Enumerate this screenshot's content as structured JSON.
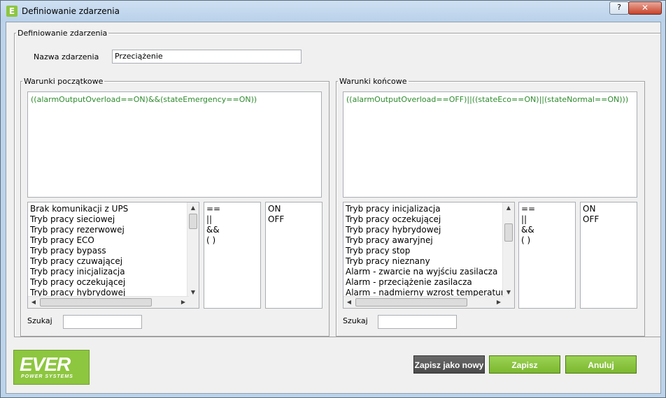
{
  "window": {
    "title": "Definiowanie zdarzenia",
    "app_icon_letter": "E",
    "help": "?",
    "close": "✕"
  },
  "main_group": {
    "legend": "Definiowanie zdarzenia"
  },
  "event_name": {
    "label": "Nazwa zdarzenia",
    "value": "Przeciążenie"
  },
  "start": {
    "legend": "Warunki początkowe",
    "condition": "((alarmOutputOverload==ON)&&(stateEmergency==ON))",
    "items": [
      "Brak komunikacji z UPS",
      "Tryb pracy sieciowej",
      "Tryb pracy rezerwowej",
      "Tryb pracy ECO",
      "Tryb pracy bypass",
      "Tryb pracy czuwającej",
      "Tryb pracy inicjalizacja",
      "Tryb pracy oczekującej",
      "Tryb pracy hybrydowej"
    ],
    "operators": [
      "==",
      "||",
      "&&",
      "( )"
    ],
    "values": [
      "ON",
      "OFF"
    ],
    "search_label": "Szukaj",
    "search_value": ""
  },
  "end": {
    "legend": "Warunki końcowe",
    "condition": "((alarmOutputOverload==OFF)||((stateEco==ON)||(stateNormal==ON)))",
    "items": [
      "Tryb pracy inicjalizacja",
      "Tryb pracy oczekującej",
      "Tryb pracy hybrydowej",
      "Tryb pracy awaryjnej",
      "Tryb pracy stop",
      "Tryb pracy nieznany",
      "Alarm - zwarcie na wyjściu zasilacza",
      "Alarm - przeciążenie zasilacza",
      "Alarm - nadmierny wzrost temperatury pro"
    ],
    "operators": [
      "==",
      "||",
      "&&",
      "( )"
    ],
    "values": [
      "ON",
      "OFF"
    ],
    "search_label": "Szukaj",
    "search_value": ""
  },
  "buttons": {
    "save_new": "Zapisz jako nowy",
    "save": "Zapisz",
    "cancel": "Anuluj"
  },
  "logo": {
    "text": "EVER",
    "tagline": "POWER SYSTEMS"
  },
  "colors": {
    "accent_green": "#8dc63f",
    "condition_text": "#2e8b2e"
  }
}
